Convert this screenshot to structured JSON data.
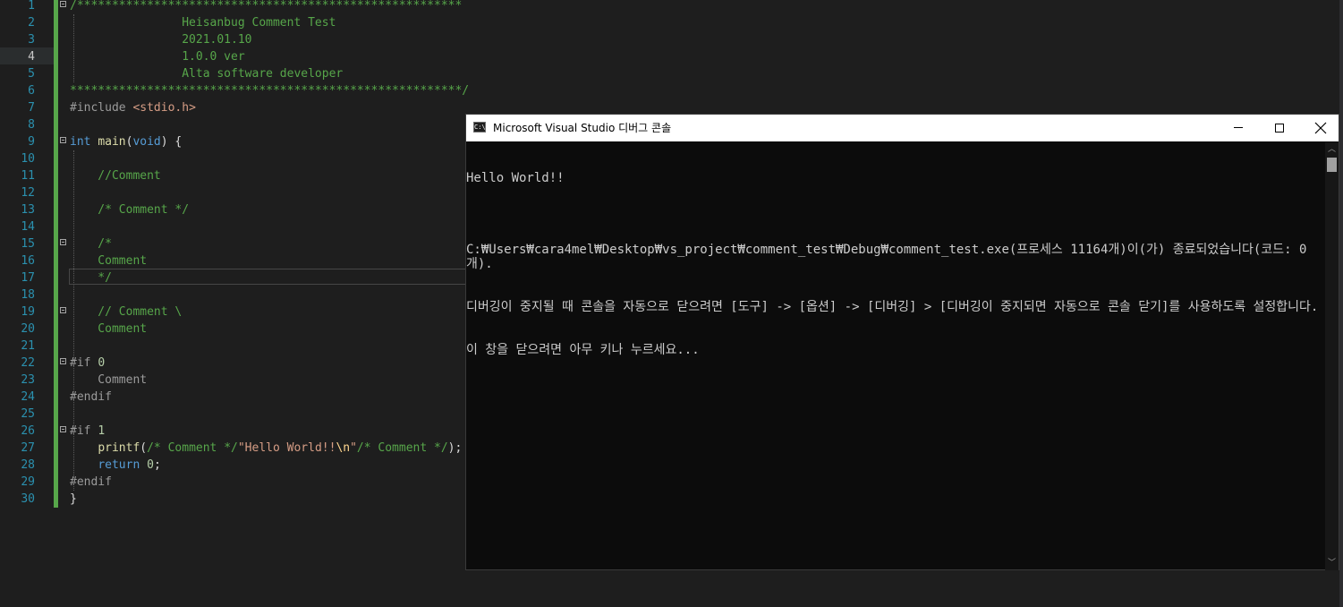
{
  "editor": {
    "current_line": 4,
    "lines": [
      {
        "n": "1",
        "tokens": [
          {
            "c": "c-comment",
            "t": "/*******************************************************"
          }
        ]
      },
      {
        "n": "2",
        "tokens": [
          {
            "c": "c-comment",
            "t": "                Heisanbug Comment Test"
          }
        ]
      },
      {
        "n": "3",
        "tokens": [
          {
            "c": "c-comment",
            "t": "                2021.01.10"
          }
        ]
      },
      {
        "n": "4",
        "tokens": [
          {
            "c": "c-comment",
            "t": "                1.0.0 ver"
          }
        ]
      },
      {
        "n": "5",
        "tokens": [
          {
            "c": "c-comment",
            "t": "                Alta software developer"
          }
        ]
      },
      {
        "n": "6",
        "tokens": [
          {
            "c": "c-comment",
            "t": "********************************************************/"
          }
        ]
      },
      {
        "n": "7",
        "tokens": [
          {
            "c": "c-pp",
            "t": "#include "
          },
          {
            "c": "c-inc",
            "t": "<stdio.h>"
          }
        ]
      },
      {
        "n": "8",
        "tokens": []
      },
      {
        "n": "9",
        "tokens": [
          {
            "c": "c-kw",
            "t": "int"
          },
          {
            "c": "c-plain",
            "t": " "
          },
          {
            "c": "c-fn",
            "t": "main"
          },
          {
            "c": "c-plain",
            "t": "("
          },
          {
            "c": "c-kw",
            "t": "void"
          },
          {
            "c": "c-plain",
            "t": ") {"
          }
        ]
      },
      {
        "n": "10",
        "tokens": []
      },
      {
        "n": "11",
        "tokens": [
          {
            "c": "c-comment",
            "t": "    //Comment"
          }
        ]
      },
      {
        "n": "12",
        "tokens": []
      },
      {
        "n": "13",
        "tokens": [
          {
            "c": "c-comment",
            "t": "    /* Comment */"
          }
        ]
      },
      {
        "n": "14",
        "tokens": []
      },
      {
        "n": "15",
        "tokens": [
          {
            "c": "c-comment",
            "t": "    /*"
          }
        ]
      },
      {
        "n": "16",
        "tokens": [
          {
            "c": "c-comment",
            "t": "    Comment"
          }
        ]
      },
      {
        "n": "17",
        "tokens": [
          {
            "c": "c-comment",
            "t": "    */"
          }
        ]
      },
      {
        "n": "18",
        "tokens": []
      },
      {
        "n": "19",
        "tokens": [
          {
            "c": "c-comment",
            "t": "    // Comment \\"
          }
        ]
      },
      {
        "n": "20",
        "tokens": [
          {
            "c": "c-comment",
            "t": "    Comment"
          }
        ]
      },
      {
        "n": "21",
        "tokens": []
      },
      {
        "n": "22",
        "tokens": [
          {
            "c": "c-pp",
            "t": "#if "
          },
          {
            "c": "c-num",
            "t": "0"
          }
        ]
      },
      {
        "n": "23",
        "tokens": [
          {
            "c": "c-pp",
            "t": "    Comment"
          }
        ]
      },
      {
        "n": "24",
        "tokens": [
          {
            "c": "c-pp",
            "t": "#endif"
          }
        ]
      },
      {
        "n": "25",
        "tokens": []
      },
      {
        "n": "26",
        "tokens": [
          {
            "c": "c-pp",
            "t": "#if "
          },
          {
            "c": "c-num",
            "t": "1"
          }
        ]
      },
      {
        "n": "27",
        "tokens": [
          {
            "c": "c-plain",
            "t": "    "
          },
          {
            "c": "c-fn",
            "t": "printf"
          },
          {
            "c": "c-plain",
            "t": "("
          },
          {
            "c": "c-comment",
            "t": "/* Comment */"
          },
          {
            "c": "c-str",
            "t": "\"Hello World!!"
          },
          {
            "c": "c-esc",
            "t": "\\n"
          },
          {
            "c": "c-str",
            "t": "\""
          },
          {
            "c": "c-comment",
            "t": "/* Comment */"
          },
          {
            "c": "c-plain",
            "t": ");"
          }
        ]
      },
      {
        "n": "28",
        "tokens": [
          {
            "c": "c-plain",
            "t": "    "
          },
          {
            "c": "c-kw",
            "t": "return"
          },
          {
            "c": "c-plain",
            "t": " "
          },
          {
            "c": "c-num",
            "t": "0"
          },
          {
            "c": "c-plain",
            "t": ";"
          }
        ]
      },
      {
        "n": "29",
        "tokens": [
          {
            "c": "c-pp",
            "t": "#endif"
          }
        ]
      },
      {
        "n": "30",
        "tokens": [
          {
            "c": "c-plain",
            "t": "}"
          }
        ]
      }
    ],
    "fold_lines": [
      "1",
      "9",
      "15",
      "19",
      "22",
      "26"
    ]
  },
  "console": {
    "icon_text": "C:\\",
    "title": "Microsoft Visual Studio 디버그 콘솔",
    "output_lines": [
      "Hello World!!",
      "",
      "C:₩Users₩cara4mel₩Desktop₩vs_project₩comment_test₩Debug₩comment_test.exe(프로세스 11164개)이(가) 종료되었습니다(코드: 0개).",
      "디버깅이 중지될 때 콘솔을 자동으로 닫으려면 [도구] -> [옵션] -> [디버깅] > [디버깅이 중지되면 자동으로 콘솔 닫기]를 사용하도록 설정합니다.",
      "이 창을 닫으려면 아무 키나 누르세요..."
    ],
    "scroll_up_glyph": "︿",
    "scroll_down_glyph": "﹀"
  }
}
